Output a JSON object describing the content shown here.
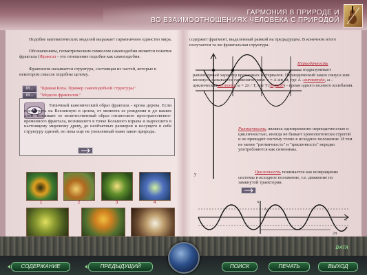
{
  "header": {
    "title_line1": "ГАРМОНИЯ В ПРИРОДЕ И",
    "title_line2": "ВО ВЗАИМООТНОШЕНИЯХ ЧЕЛОВЕКА С ПРИРОДОЙ",
    "icon": "violin-icon"
  },
  "left_page": {
    "p1": "Подобие математических моделей выражает гармоничное единство мира.",
    "p2_a": "Обозначением, геометрическим символом самоподобия является понятие фрактала (",
    "p2_link": "Фрактал",
    "p2_b": " - это отношение подобия как самоподобия.",
    "p3": "Фракталом называется структура, состоящая из частей, которые в некотором смысле подобны целому.",
    "media1_btn": "М...",
    "media1_label": "\"Кривая Коха. Пример самоподобной структуры\"",
    "media2_btn": "М...",
    "media2_label": "\"Модели фракталов.\"",
    "quote": "Типичный канонический образ фрактала - крона дерева. Если посмотреть на Вселенную в целом, от момента ее рождения и до наших дней, возникает ее величественный образ гигантского пространственно-временного фрактала, возникшего в точке Большого взрыва и выросшего в настоящему мировому древу, до необъятных размеров и несущего в себе структуру единой, но пока еще не уловленный нами закон природы.",
    "thumb_numbers": [
      "1",
      "2",
      "3",
      "4"
    ]
  },
  "right_page": {
    "intro": "содержит фрагмент, выделенный рамкой на предыдущем. В конечном итоге получается та же фрактальная структура.",
    "periodicity_link": "Периодичность",
    "periodicity_text": "подразумевает равномерный характер временных интервалов. Периодический закон синуса или косинуса называется гармоническим: x = A sin ωt, где A -",
    "amplitude_link": "амплитуда",
    "omega_text": ", ω - циклическая",
    "frequency_link": "частота",
    "period_text": ", ω = 2π / T, где T (",
    "period_link": "период",
    "period_text2": ") - время одного полного колебания.",
    "rhythm_link": "Ритмичность",
    "rhythm_text": ", являясь одновременно периодичностью и цикличностью, иногда не бывает хронологически строгой и не приводит систему точно в исходное положение. И тем не менее \"ритмичность\" и \"цикличность\" нередко употребляются как синонимы.",
    "cyclic_link": "Цикличность",
    "cyclic_text": "понимается как возвращение системы в исходное положение, т.е. движение по замкнутой траектории.",
    "axis_y": "y",
    "axis_x": "x",
    "axis_t": "t",
    "axis_a": "A",
    "axis_2pi": "2π"
  },
  "nav": {
    "contents": "СОДЕРЖАНИЕ",
    "previous": "ПРЕДЫДУЩИЙ",
    "search": "ПОИСК",
    "print": "ПЕЧАТЬ",
    "exit": "ВЫХОД",
    "brand": "DATA"
  },
  "colors": {
    "accent_red": "#b01e2e",
    "nav_green": "#2b6a3e",
    "page": "#eddede"
  }
}
